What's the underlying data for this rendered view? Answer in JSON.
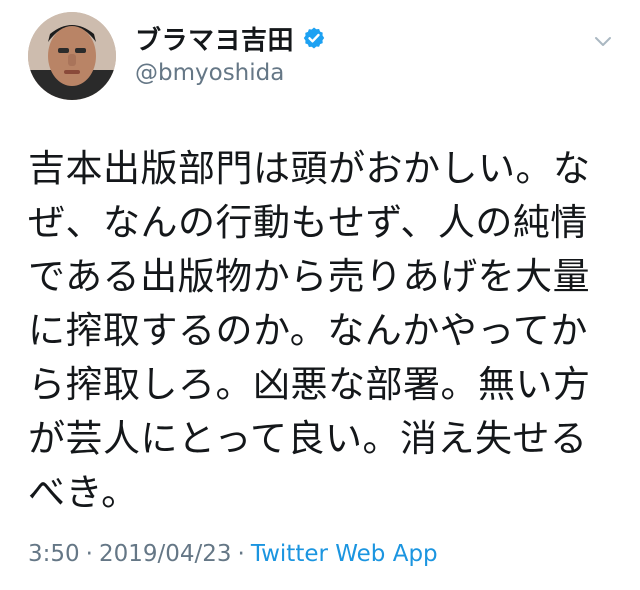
{
  "user": {
    "display_name": "ブラマヨ吉田",
    "handle": "@bmyoshida",
    "verified": true
  },
  "icons": {
    "avatar": "avatar",
    "verified": "verified-badge-icon",
    "menu": "chevron-down-icon"
  },
  "tweet": {
    "text": "吉本出版部門は頭がおかしい。な\nぜ、なんの行動もせず、人の純情\nである出版物から売りあげを大量\nに搾取するのか。なんかやってか\nら搾取しろ。凶悪な部署。無い方\nが芸人にとって良い。消え失せる\nべき。",
    "time": "3:50",
    "separator": "·",
    "date": "2019/04/23",
    "source": "Twitter Web App"
  },
  "colors": {
    "text": "#14171a",
    "muted": "#657786",
    "accent": "#1b95e0",
    "verified": "#1da1f2"
  }
}
